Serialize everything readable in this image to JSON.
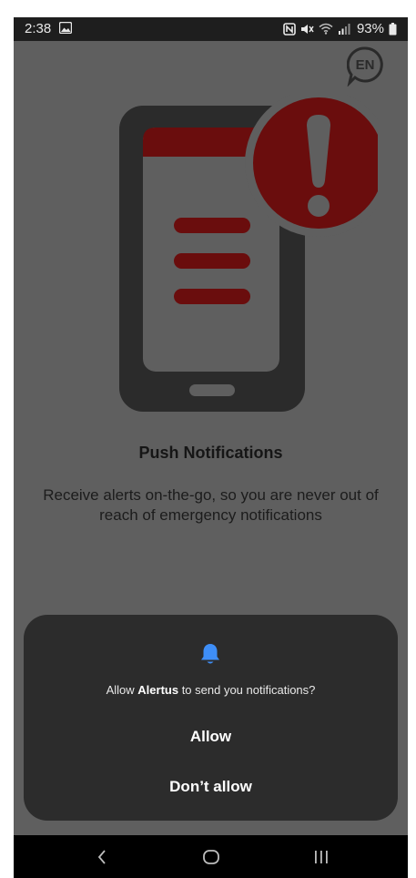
{
  "status_bar": {
    "time": "2:38",
    "battery": "93%"
  },
  "language": {
    "code": "EN"
  },
  "onboarding": {
    "title": "Push Notifications",
    "description": "Receive alerts on-the-go, so you are never out of reach of emergency notifications"
  },
  "dialog": {
    "message_prefix": "Allow ",
    "app_name": "Alertus",
    "message_suffix": " to send you notifications?",
    "allow_label": "Allow",
    "deny_label": "Don’t allow"
  },
  "colors": {
    "scrim_background": "#5f5f5f",
    "phone_body": "#2b2b2b",
    "alert_red": "#6a0d0d",
    "dialog_background": "#2c2c2c",
    "bell_blue": "#3e8ef7"
  },
  "icons": {
    "status_left": "gallery-icon",
    "status_right": [
      "nfc-icon",
      "mute-icon",
      "wifi-icon",
      "signal-icon",
      "battery-icon"
    ],
    "dialog": "bell-icon",
    "nav": [
      "back-icon",
      "home-icon",
      "recent-apps-icon"
    ]
  }
}
